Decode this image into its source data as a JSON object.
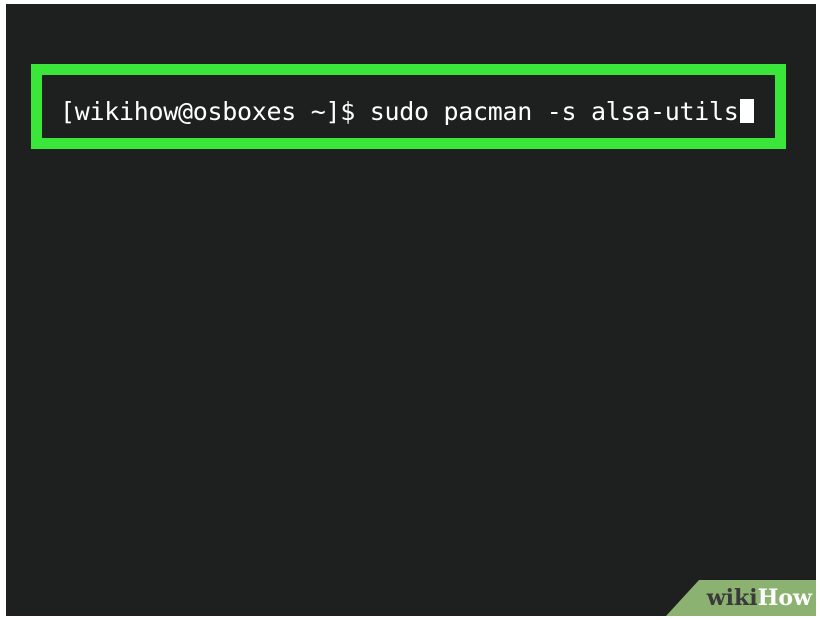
{
  "terminal": {
    "prompt": "[wikihow@osboxes ~]$ ",
    "command": "sudo pacman -s alsa-utils"
  },
  "watermark": {
    "part1": "wiki",
    "part2": "How"
  },
  "colors": {
    "terminal_background": "#1e2020",
    "highlight_border": "#39e639",
    "text": "#ffffff",
    "watermark_background": "#8bb270"
  }
}
